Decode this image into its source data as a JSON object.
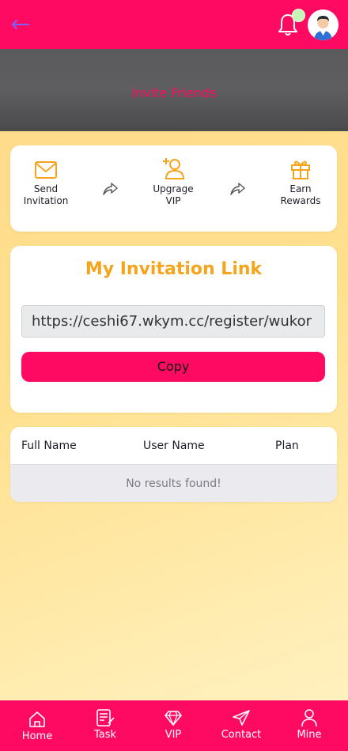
{
  "header": {
    "back_icon": "back-arrow-icon",
    "bell_icon": "bell-icon",
    "avatar": "user-avatar"
  },
  "hero": {
    "title": "Invite Friends"
  },
  "steps": [
    {
      "label": "Send Invitation",
      "line1": "Send",
      "line2": "Invitation",
      "icon": "envelope-icon"
    },
    {
      "label": "Upgrage VIP",
      "line1": "Upgrage",
      "line2": "VIP",
      "icon": "add-user-icon"
    },
    {
      "label": "Earn Rewards",
      "line1": "Earn",
      "line2": "Rewards",
      "icon": "gift-icon"
    }
  ],
  "invitation": {
    "title": "My Invitation Link",
    "link": "https://ceshi67.wkym.cc/register/wukor",
    "copy_label": "Copy"
  },
  "table": {
    "columns": [
      "Full Name",
      "User Name",
      "Plan"
    ],
    "empty_message": "No results found!"
  },
  "nav": [
    {
      "label": "Home",
      "icon": "home-icon"
    },
    {
      "label": "Task",
      "icon": "task-icon"
    },
    {
      "label": "VIP",
      "icon": "diamond-icon"
    },
    {
      "label": "Contact",
      "icon": "paper-plane-icon"
    },
    {
      "label": "Mine",
      "icon": "user-icon"
    }
  ],
  "colors": {
    "primary": "#ff0a63",
    "accent": "#f5a41b",
    "hero_bg": "#5b5b5d"
  }
}
